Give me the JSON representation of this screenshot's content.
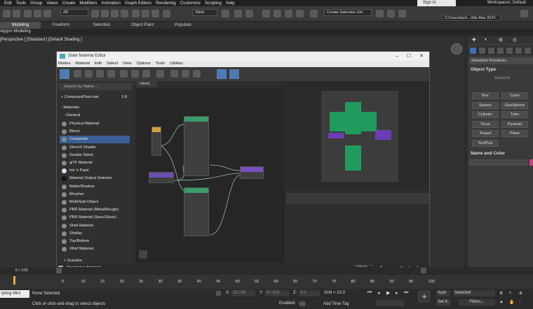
{
  "menubar": [
    "Edit",
    "Tools",
    "Group",
    "Views",
    "Create",
    "Modifiers",
    "Animation",
    "Graph Editors",
    "Rendering",
    "Customize",
    "Scripting",
    "Help"
  ],
  "signin": "Sign In",
  "workspaces": {
    "label": "Workspaces:",
    "value": "Default"
  },
  "toolbar": {
    "filter": "All",
    "view": "View",
    "selection_set": "Create Selection Set",
    "path": "C:\\Users\\lach...\\3ds Max 2024"
  },
  "ribbon_tabs": [
    "Modeling",
    "Freeform",
    "Selection",
    "Object Paint",
    "Populate"
  ],
  "poly_label": "olygon Modeling",
  "viewport_label": "[Perspective ] [Standard ] [Default Shading ]",
  "sme": {
    "title": "Slate Material Editor",
    "menu": [
      "Modes",
      "Material",
      "Edit",
      "Select",
      "View",
      "Options",
      "Tools",
      "Utilities"
    ],
    "search_placeholder": "Search by Name ...",
    "compound": "+ CompoundTest.mat",
    "compound_count": "1:8",
    "materials_header": "- Materials",
    "general_header": "- General",
    "materials": [
      "Physical Material",
      "Blend",
      "Composite",
      "DirectX Shader",
      "Double Sided",
      "glTF Material",
      "Ink 'n Paint",
      "Material Output Selector",
      "Matte/Shadow",
      "Morpher",
      "Multi/Sub-Object",
      "PBR Material (Metal/Rough)",
      "PBR Material (Spec/Gloss)",
      "Shell Material",
      "Shellac",
      "Top/Bottom",
      "XRef Material"
    ],
    "scanline": "+ Scanline",
    "view_tab": "View1",
    "status": "Rendering finished",
    "zoom": "100 %"
  },
  "command_panel": {
    "dropdown": "Standard Primitives",
    "object_type": "Object Type",
    "autogrid": "AutoGrid",
    "buttons": [
      "Box",
      "Cone",
      "Sphere",
      "GeoSphere",
      "Cylinder",
      "Tube",
      "Torus",
      "Pyramid",
      "Teapot",
      "Plane",
      "TextPlus"
    ],
    "name_color": "Name and Color"
  },
  "timeline": {
    "frame": "0 / 100"
  },
  "ruler_ticks": [
    "5",
    "10",
    "15",
    "20",
    "25",
    "30",
    "35",
    "40",
    "45",
    "50",
    "55",
    "60",
    "65",
    "70",
    "75",
    "80",
    "85",
    "90",
    "95",
    "100"
  ],
  "status": {
    "none_selected": "None Selected",
    "hint": "Click or click-and-drag to select objects",
    "x_label": "X:",
    "x_value": "16.708",
    "y_label": "Y:",
    "y_value": "67.918",
    "z_label": "Z:",
    "z_value": "0.0",
    "grid": "Grid = 10.0",
    "enabled": "Enabled:",
    "add_time_tag": "Add Time Tag",
    "auto": "Auto",
    "setk": "Set K.",
    "selected": "Selected",
    "filters": "Filters...",
    "script": "ipting Mini"
  }
}
